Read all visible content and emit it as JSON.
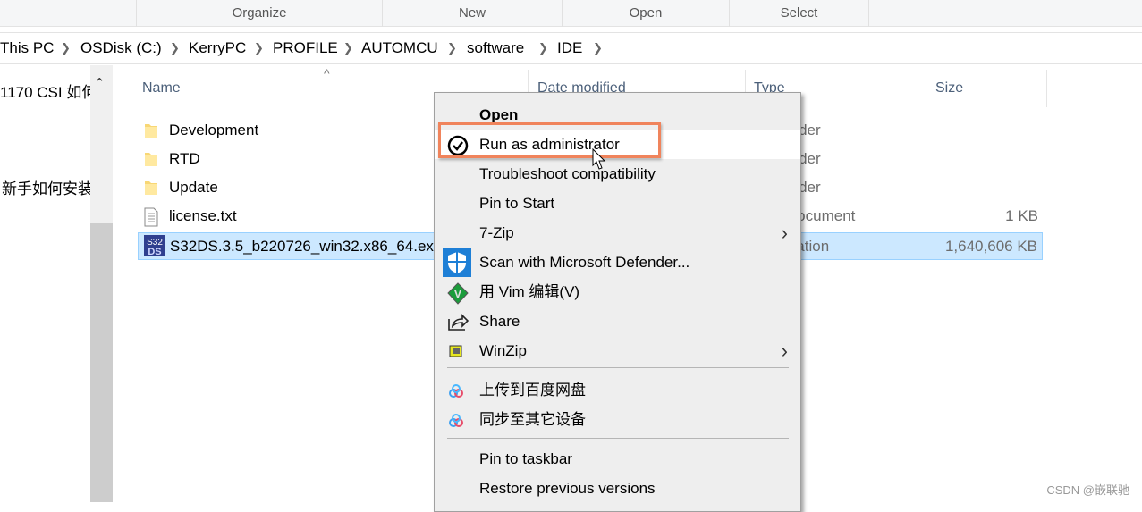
{
  "ribbon": {
    "groups": [
      "Organize",
      "New",
      "Open",
      "Select"
    ]
  },
  "breadcrumb": [
    "This PC",
    "OSDisk (C:)",
    "KerryPC",
    "PROFILE",
    "AUTOMCU",
    "software",
    "IDE"
  ],
  "nav": {
    "items": [
      "1170 CSI 如何",
      "新手如何安装"
    ]
  },
  "columns": {
    "name": "Name",
    "date": "Date modified",
    "type": "Type",
    "size": "Size"
  },
  "files": [
    {
      "name": "Development",
      "type": "File folder",
      "size": "",
      "icon": "folder-icon"
    },
    {
      "name": "RTD",
      "type": "File folder",
      "size": "",
      "icon": "folder-icon"
    },
    {
      "name": "Update",
      "type": "File folder",
      "size": "",
      "icon": "folder-icon"
    },
    {
      "name": "license.txt",
      "type": "Text Document",
      "size": "1 KB",
      "icon": "text-file-icon"
    },
    {
      "name": "S32DS.3.5_b220726_win32.x86_64.exe",
      "type": "Application",
      "size": "1,640,606 KB",
      "icon": "s32ds-app-icon",
      "selected": true
    }
  ],
  "menu": {
    "items": [
      {
        "label": "Open",
        "bold": true
      },
      {
        "label": "Run as administrator",
        "icon": "admin-check-icon",
        "hover": true
      },
      {
        "label": "Troubleshoot compatibility"
      },
      {
        "label": "Pin to Start"
      },
      {
        "label": "7-Zip",
        "submenu": true
      },
      {
        "label": "Scan with Microsoft Defender...",
        "icon": "defender-shield-icon"
      },
      {
        "label": "用 Vim 编辑(V)",
        "icon": "vim-icon"
      },
      {
        "label": "Share",
        "icon": "share-icon"
      },
      {
        "label": "WinZip",
        "icon": "winzip-icon",
        "submenu": true
      },
      {
        "label": "上传到百度网盘",
        "icon": "baidu-netdisk-icon"
      },
      {
        "label": "同步至其它设备",
        "icon": "baidu-netdisk-icon"
      },
      {
        "label": "Pin to taskbar"
      },
      {
        "label": "Restore previous versions"
      }
    ]
  },
  "watermark": "CSDN @嵌联驰",
  "colors": {
    "selection": "#cce8ff",
    "highlight_box": "#f0845c",
    "menu_bg": "#eeeeee"
  }
}
